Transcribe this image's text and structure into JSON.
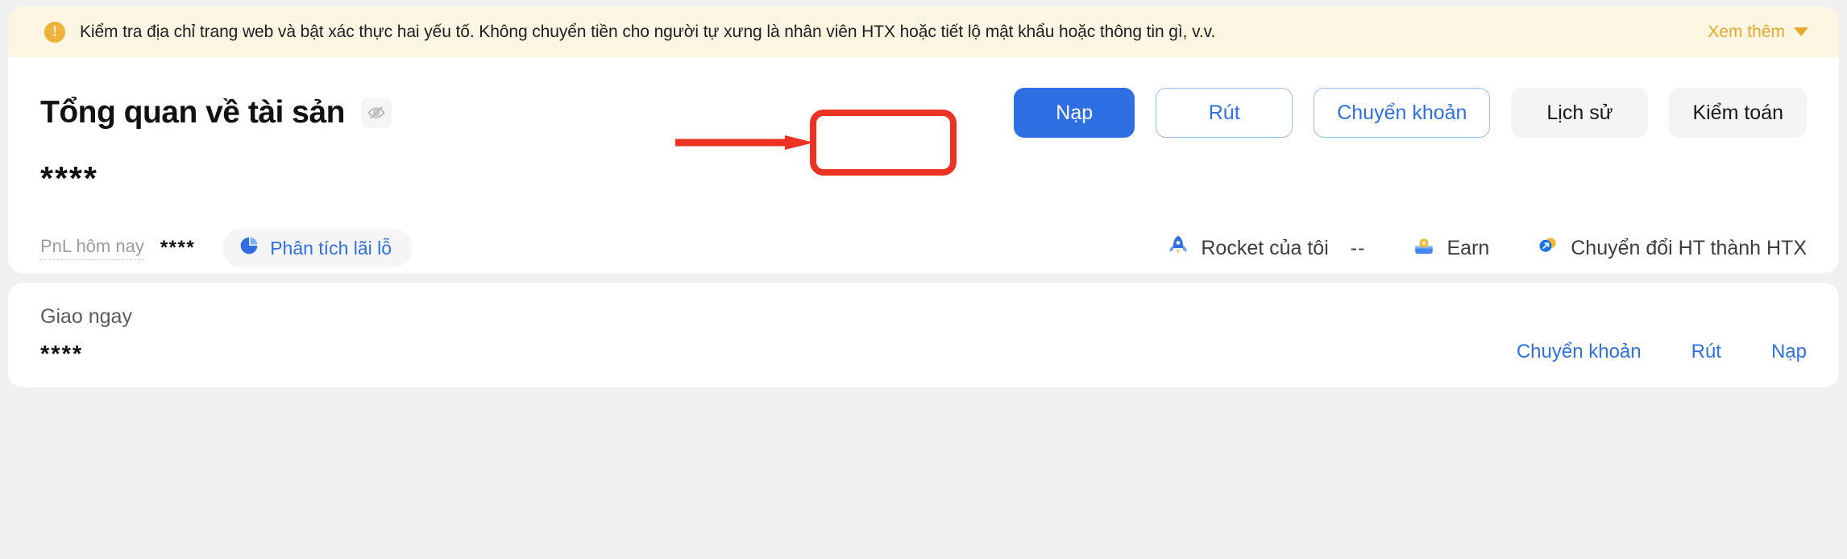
{
  "banner": {
    "icon": "warning-exclamation-icon",
    "text": "Kiểm tra địa chỉ trang web và bật xác thực hai yếu tố. Không chuyển tiền cho người tự xưng là nhân viên HTX hoặc tiết lộ mật khẩu hoặc thông tin gì, v.v.",
    "more_label": "Xem thêm",
    "more_icon": "chevron-down-icon",
    "bg_color": "#fdf6e3",
    "accent_color": "#e9a72c"
  },
  "overview": {
    "title": "Tổng quan về tài sản",
    "visibility_icon": "eye-off-icon",
    "balance": "****",
    "pnl_label": "PnL hôm nay",
    "pnl_value": "****",
    "analysis_chip": {
      "icon": "pie-chart-icon",
      "label": "Phân tích lãi lỗ"
    },
    "actions": [
      {
        "label": "Nạp",
        "style": "primary",
        "name": "deposit-button"
      },
      {
        "label": "Rút",
        "style": "outline",
        "name": "withdraw-button"
      },
      {
        "label": "Chuyển khoản",
        "style": "outline",
        "name": "transfer-button"
      },
      {
        "label": "Lịch sử",
        "style": "ghost",
        "name": "history-button"
      },
      {
        "label": "Kiểm toán",
        "style": "ghost",
        "name": "audit-button"
      }
    ],
    "quick_links": [
      {
        "icon": "rocket-icon",
        "label": "Rocket của tôi",
        "value": "--",
        "name": "my-rocket-link"
      },
      {
        "icon": "earn-icon",
        "label": "Earn",
        "value": "",
        "name": "earn-link"
      },
      {
        "icon": "convert-arrow-icon",
        "label": "Chuyển đổi HT thành HTX",
        "value": "",
        "name": "convert-ht-link"
      }
    ]
  },
  "spot": {
    "title": "Giao ngay",
    "balance": "****",
    "links": [
      {
        "label": "Chuyển khoản",
        "name": "spot-transfer-link"
      },
      {
        "label": "Rút",
        "name": "spot-withdraw-link"
      },
      {
        "label": "Nạp",
        "name": "spot-deposit-link"
      }
    ]
  },
  "annotation": {
    "target": "deposit-button",
    "color": "#eb3223"
  }
}
